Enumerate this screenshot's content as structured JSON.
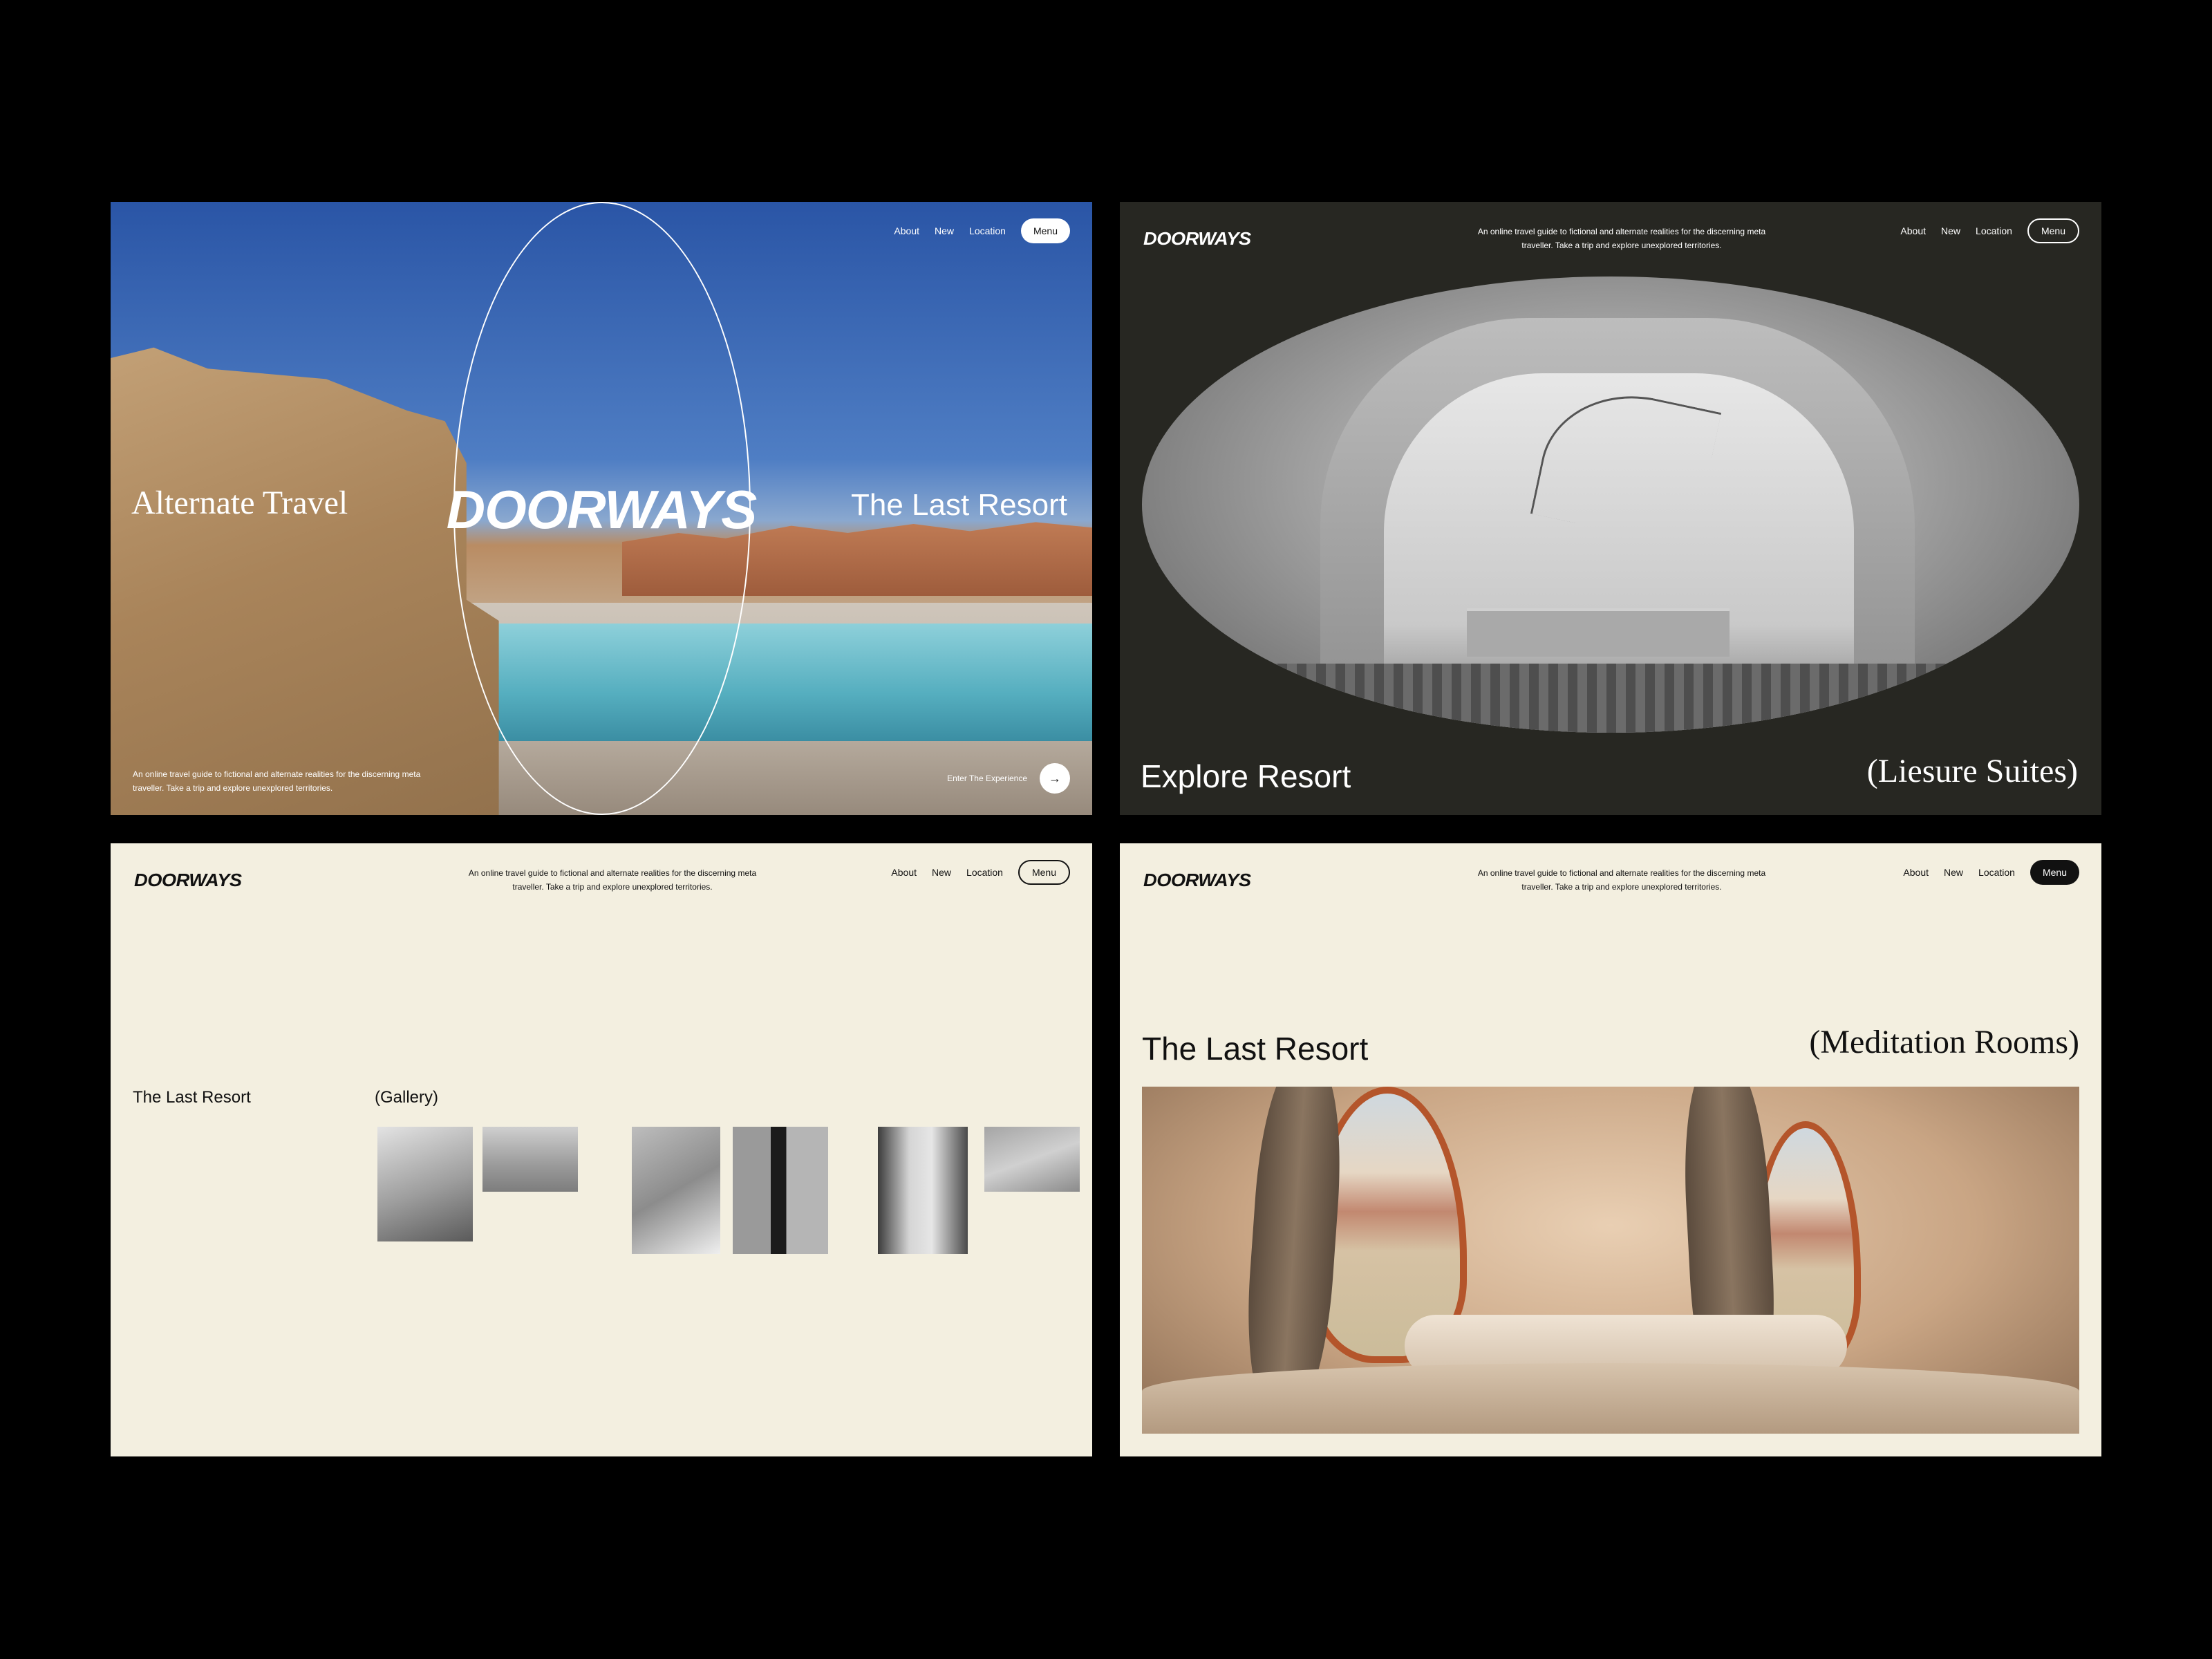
{
  "brand": "DOORWAYS",
  "tagline": "An online travel guide to fictional and alternate realities for the discerning meta traveller. Take a trip and explore unexplored territories.",
  "nav": {
    "about": "About",
    "new": "New",
    "location": "Location",
    "menu": "Menu"
  },
  "hero": {
    "left_title": "Alternate Travel",
    "logo": "DOORWAYS",
    "right_title": "The Last Resort",
    "description": "An online travel guide to fictional and alternate realities for the discerning meta traveller. Take a trip and explore unexplored territories.",
    "cta_label": "Enter The Experience",
    "cta_icon": "arrow-right-icon"
  },
  "explore": {
    "title": "Explore Resort",
    "subtitle": "(Liesure Suites)"
  },
  "gallery_page": {
    "title": "The Last Resort",
    "gallery_label": "(Gallery)",
    "thumbnail_count": 6
  },
  "meditation": {
    "title": "The Last Resort",
    "subtitle": "(Meditation Rooms)"
  },
  "colors": {
    "background": "#000000",
    "cream": "#f3efe0",
    "dark_panel": "#272722",
    "accent": "#b4552b"
  }
}
